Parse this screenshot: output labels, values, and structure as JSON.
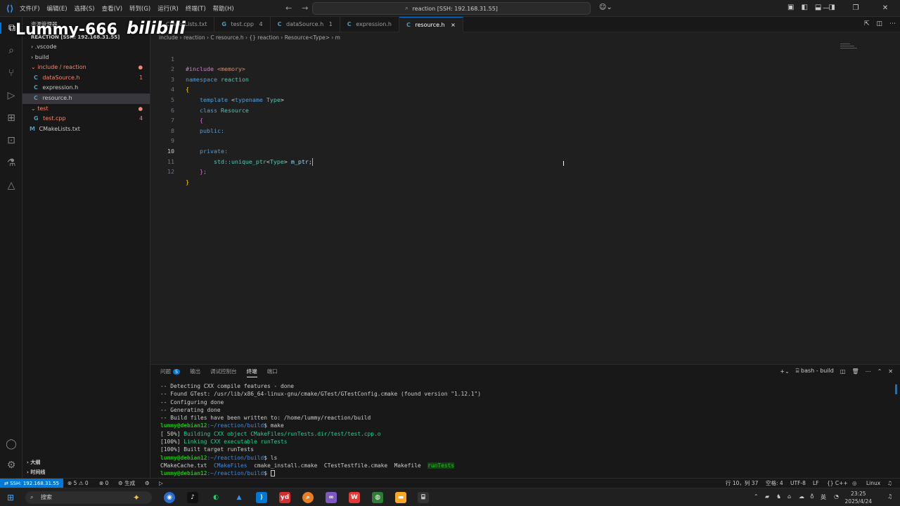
{
  "titlebar": {
    "menu": [
      "文件(F)",
      "编辑(E)",
      "选择(S)",
      "查看(V)",
      "转到(G)",
      "运行(R)",
      "终端(T)",
      "帮助(H)"
    ],
    "command_center": "reaction [SSH: 192.168.31.55]"
  },
  "watermark": {
    "user": "Lummy-666",
    "brand": "bilibili"
  },
  "sidebar": {
    "title": "资源管理器",
    "section": "REACTION [SSH: 192.168.31.55]",
    "items": [
      {
        "label": ".vscode",
        "arrow": "›"
      },
      {
        "label": "build",
        "arrow": "›"
      },
      {
        "label": "include / reaction",
        "arrow": "⌄",
        "badge": "●"
      },
      {
        "label": "dataSource.h",
        "badge": "1"
      },
      {
        "label": "expression.h"
      },
      {
        "label": "resource.h"
      },
      {
        "label": "test",
        "arrow": "⌄",
        "badge": "●"
      },
      {
        "label": "test.cpp",
        "badge": "4"
      },
      {
        "label": "CMakeLists.txt"
      }
    ],
    "outline": "大纲",
    "timeline": "时间线"
  },
  "tabs": [
    {
      "label": "CMakeLists.txt"
    },
    {
      "label": "test.cpp",
      "count": "4"
    },
    {
      "label": "dataSource.h",
      "count": "1"
    },
    {
      "label": "expression.h"
    },
    {
      "label": "resource.h",
      "close": "×"
    }
  ],
  "breadcrumb": {
    "parts": [
      "include",
      "reaction",
      "C resource.h",
      "{} reaction",
      "Resource<Type>",
      "m"
    ],
    "sep": "›"
  },
  "editor": {
    "line_numbers": [
      "1",
      "2",
      "3",
      "4",
      "5",
      "6",
      "7",
      "8",
      "9",
      "10",
      "11",
      "12"
    ],
    "current_line": "10",
    "code": {
      "l1_kw": "#include",
      "l1_hdr": "<memory>",
      "l2_kw": "namespace",
      "l2_nm": "reaction",
      "l3": "{",
      "l4_kw": "template",
      "l4_a": "<",
      "l4_kw2": "typename",
      "l4_ty": "Type",
      "l4_b": ">",
      "l5_kw": "class",
      "l5_nm": "Resource",
      "l6": "{",
      "l7": "public:",
      "l9": "private:",
      "l10_ns": "std::",
      "l10_ty": "unique_ptr",
      "l10_a": "<",
      "l10_ty2": "Type",
      "l10_b": ">",
      "l10_var": "m_ptr",
      "l10_semi": ";",
      "l11": "};",
      "l12": "}"
    }
  },
  "panel": {
    "tabs": [
      "问题",
      "输出",
      "调试控制台",
      "终端",
      "端口"
    ],
    "problems_count": "5",
    "terminal_name": "bash - build",
    "lines": {
      "t1": "-- Detecting CXX compile features - done",
      "t2": "-- Found GTest: /usr/lib/x86_64-linux-gnu/cmake/GTest/GTestConfig.cmake (found version \"1.12.1\")",
      "t3": "-- Configuring done",
      "t4": "-- Generating done",
      "t5": "-- Build files have been written to: /home/lummy/reaction/build",
      "prompt_user": "lummy@debian12",
      "prompt_path": ":~/reaction/build",
      "t6_cmd": "$ make",
      "t7_pct": "[ 50%]",
      "t7_msg": " Building CXX object CMakeFiles/runTests.dir/test/test.cpp.o",
      "t8_pct": "[100%]",
      "t8_msg": " Linking CXX executable runTests",
      "t9": "[100%] Built target runTests",
      "t10_cmd": "$ ls",
      "ls_1": "CMakeCache.txt",
      "ls_2": "CMakeFiles",
      "ls_3": "cmake_install.cmake",
      "ls_4": "CTestTestfile.cmake",
      "ls_5": "Makefile",
      "ls_6": "runTests",
      "t12_cmd": "$ "
    }
  },
  "statusbar": {
    "remote": "SSH: 192.168.31.55",
    "errors": "⊗ 5 ⚠ 0",
    "ports": "⊗ 0",
    "build": "⚙ 生成",
    "position": "行 10，列 37",
    "spaces": "空格: 4",
    "encoding": "UTF-8",
    "eol": "LF",
    "language": "{} C++",
    "os": "Linux"
  },
  "taskbar": {
    "search": "搜索",
    "time": "23:25",
    "date": "2025/4/24",
    "ime": "英"
  },
  "colors": {
    "accent": "#0078d4",
    "bg": "#1f1f1f",
    "sidebar": "#181818"
  }
}
